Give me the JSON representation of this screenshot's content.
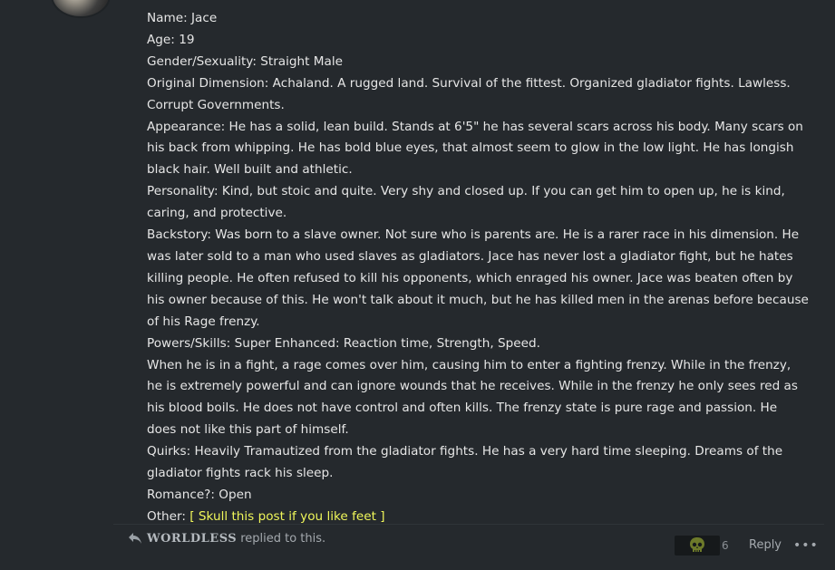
{
  "post": {
    "lines": [
      "Name: Jace",
      "Age: 19",
      "Gender/Sexuality: Straight Male",
      "Original Dimension: Achaland. A rugged land. Survival of the fittest. Organized gladiator fights. Lawless. Corrupt Governments.",
      "Appearance: He has a solid, lean build. Stands at 6'5\" he has several scars across his body. Many scars on his back from whipping. He has bold blue eyes, that almost seem to glow in the low light. He has longish black hair. Well built and athletic.",
      "Personality: Kind, but stoic and quite. Very shy and closed up. If you can get him to open up, he is kind, caring, and protective.",
      "Backstory: Was born to a slave owner. Not sure who is parents are. He is a rarer race in his dimension. He was later sold to a man who used slaves as gladiators. Jace has never lost a gladiator fight, but he hates killing people. He often refused to kill his opponents, which enraged his owner. Jace was beaten often by his owner because of this. He won't talk about it much, but he has killed men in the arenas before because of his Rage frenzy.",
      "Powers/Skills: Super Enhanced: Reaction time, Strength, Speed.",
      "When he is in a fight, a rage comes over him, causing him to enter a fighting frenzy. While in the frenzy, he is extremely powerful and can ignore wounds that he receives. While in the frenzy he only sees red as his blood boils. He does not have control and often kills. The frenzy state is pure rage and passion. He does not like this part of himself.",
      "Quirks: Heavily Tramautized from the gladiator fights. He has a very hard time sleeping. Dreams of the gladiator fights rack his sleep.",
      "Romance?: Open"
    ],
    "other_label": "Other: ",
    "other_link": "[ Skull this post if you like feet ]",
    "link_color": "#eff65a"
  },
  "footer": {
    "replied_user": "WORLDLESS",
    "replied_text": "replied to this.",
    "reaction_icon": "skull-icon",
    "reaction_count": "6",
    "reply_label": "Reply",
    "more_label": "•••"
  }
}
